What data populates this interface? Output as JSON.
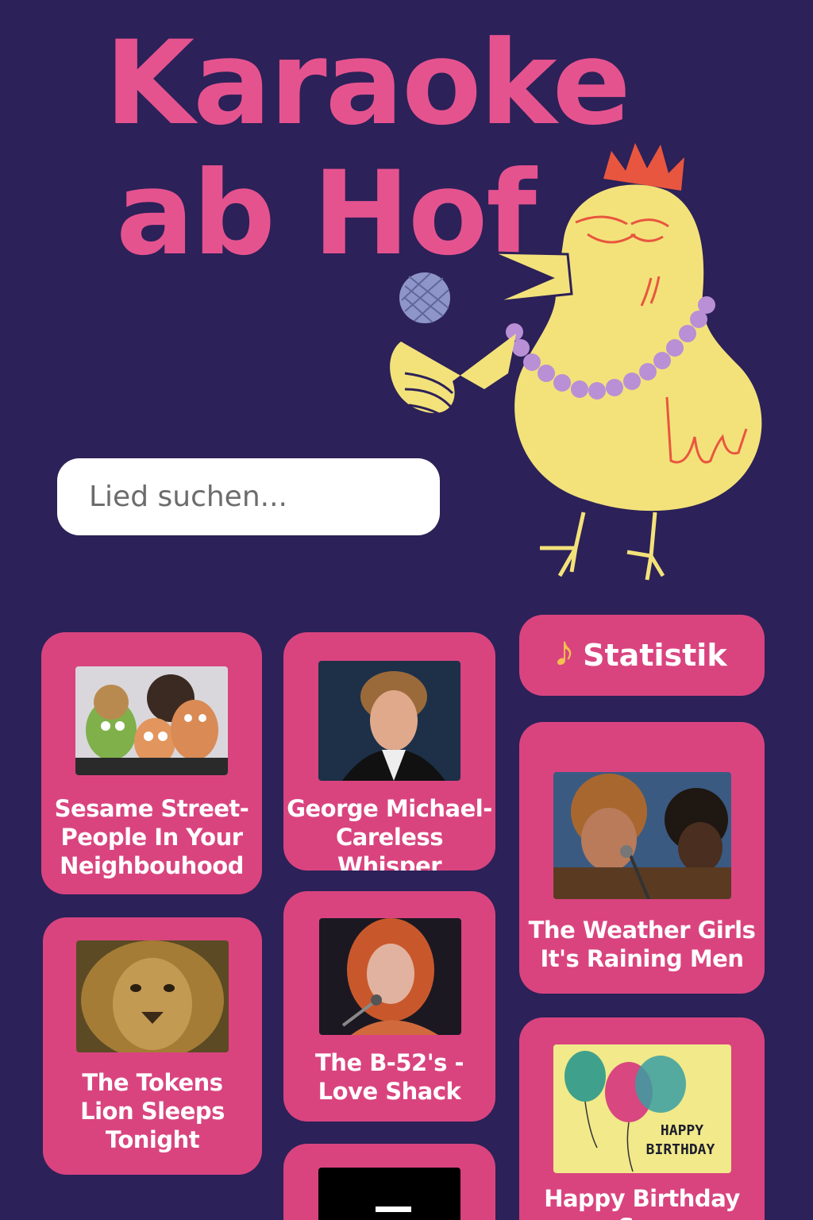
{
  "header": {
    "title_line1": "Karaoke",
    "title_line2": "ab Hof"
  },
  "search": {
    "placeholder": "Lied suchen..."
  },
  "stats_button": {
    "label": "Statistik",
    "icon": "music-note-icon"
  },
  "songs": [
    {
      "label": "Sesame Street-\nPeople In Your\nNeighbouhood",
      "thumb": "muppets"
    },
    {
      "label": "George Michael-\nCareless Whisper",
      "thumb": "singer-man"
    },
    {
      "label": "The Weather Girls\nIt's Raining Men",
      "thumb": "two-singers"
    },
    {
      "label": "The Tokens\nLion Sleeps\nTonight",
      "thumb": "lion"
    },
    {
      "label": "The B-52's -\nLove Shack",
      "thumb": "redhead-singer"
    },
    {
      "label": "Happy Birthday Son",
      "thumb": "balloons"
    },
    {
      "label": "",
      "thumb": "black-video"
    }
  ],
  "birthday_card": {
    "text1": "HAPPY",
    "text2": "BIRTHDAY"
  },
  "colors": {
    "background": "#2c2158",
    "accent": "#e5538f",
    "card": "#d9447f",
    "chick": "#f3e27a"
  }
}
